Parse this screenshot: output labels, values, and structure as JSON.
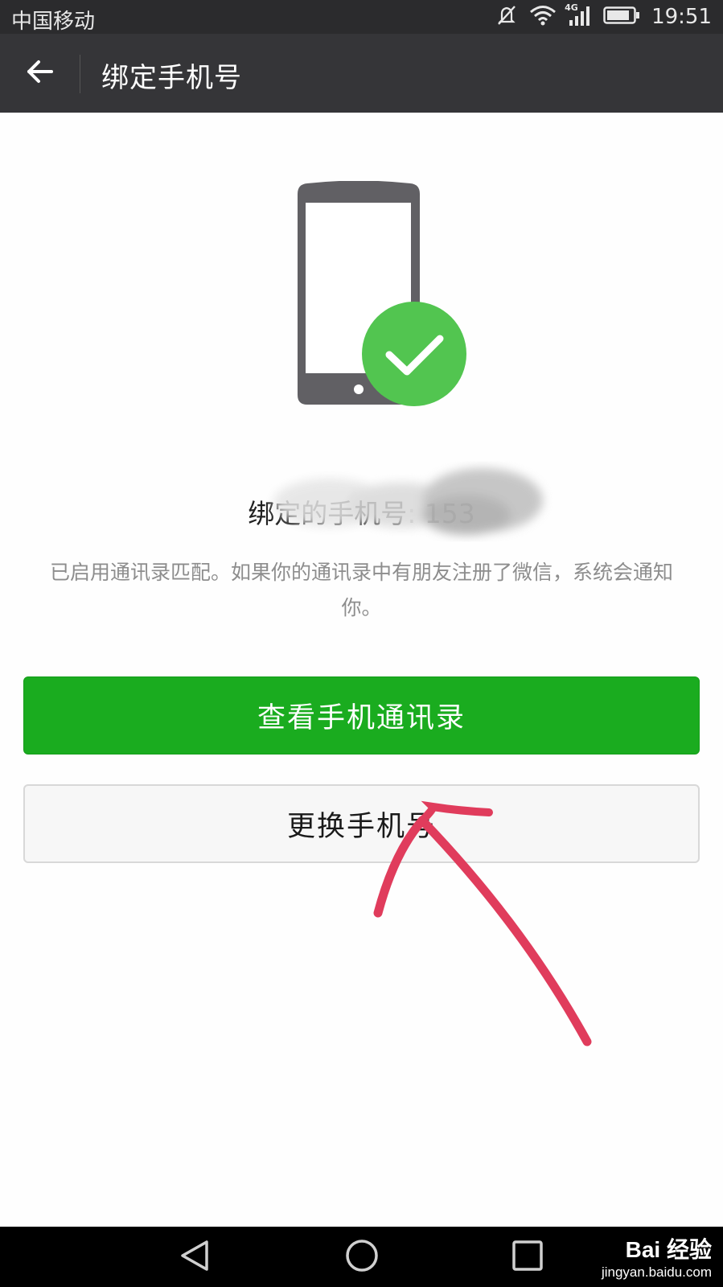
{
  "status_bar": {
    "carrier": "中国移动",
    "network_label": "4G",
    "time": "19:51",
    "icons": [
      "mute-icon",
      "wifi-icon",
      "signal-icon",
      "battery-icon"
    ]
  },
  "app_bar": {
    "title": "绑定手机号",
    "back_icon": "arrow-left-icon"
  },
  "illustration": {
    "phone_icon": "smartphone-icon",
    "check_icon": "check-circle-icon",
    "check_color": "#52c550"
  },
  "bound_phone": {
    "label": "绑定的手机号",
    "value": ": 153"
  },
  "hint": "已启用通讯录匹配。如果你的通讯录中有朋友注册了微信，系统会通知你。",
  "buttons": {
    "view_contacts": "查看手机通讯录",
    "change_number": "更换手机号"
  },
  "colors": {
    "primary_green": "#1aac1f",
    "app_bar": "#353538",
    "annotation": "#e03c5c"
  },
  "nav_bar": {
    "icons": [
      "nav-back-icon",
      "nav-home-icon",
      "nav-recents-icon"
    ]
  },
  "watermark": {
    "brand": "Bai 经验",
    "url": "jingyan.baidu.com"
  }
}
